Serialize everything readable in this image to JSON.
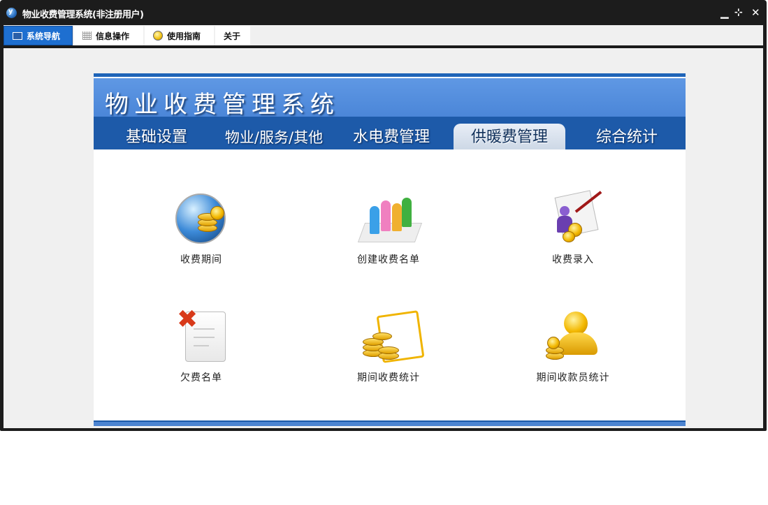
{
  "window": {
    "title": "物业收费管理系统(非注册用户)",
    "controls": [
      "minimize-icon",
      "restore-icon",
      "close-icon"
    ]
  },
  "menu": {
    "items": [
      {
        "label": "系统导航",
        "icon": "screen-icon",
        "active": true
      },
      {
        "label": "信息操作",
        "icon": "grid-icon",
        "active": false
      },
      {
        "label": "使用指南",
        "icon": "lightbulb-icon",
        "active": false
      },
      {
        "label": "关于",
        "icon": "",
        "active": false
      }
    ]
  },
  "banner": {
    "title": "物业收费管理系统"
  },
  "tabs": [
    {
      "label": "基础设置",
      "active": false
    },
    {
      "label": "物业/服务/其他",
      "active": false
    },
    {
      "label": "水电费管理",
      "active": false
    },
    {
      "label": "供暖费管理",
      "active": true
    },
    {
      "label": "综合统计",
      "active": false
    }
  ],
  "features": [
    {
      "label": "收费期间",
      "icon": "globe-coins-icon"
    },
    {
      "label": "创建收费名单",
      "icon": "people-group-icon"
    },
    {
      "label": "收费录入",
      "icon": "person-coins-icon"
    },
    {
      "label": "欠费名单",
      "icon": "document-delete-icon"
    },
    {
      "label": "期间收费统计",
      "icon": "coins-chart-icon"
    },
    {
      "label": "期间收款员统计",
      "icon": "gold-person-icon"
    }
  ],
  "colors": {
    "accent": "#1e6fd0",
    "banner": "#5f98e4",
    "tab_bar": "#1d5aa9",
    "titlebar": "#1c1c1c"
  }
}
